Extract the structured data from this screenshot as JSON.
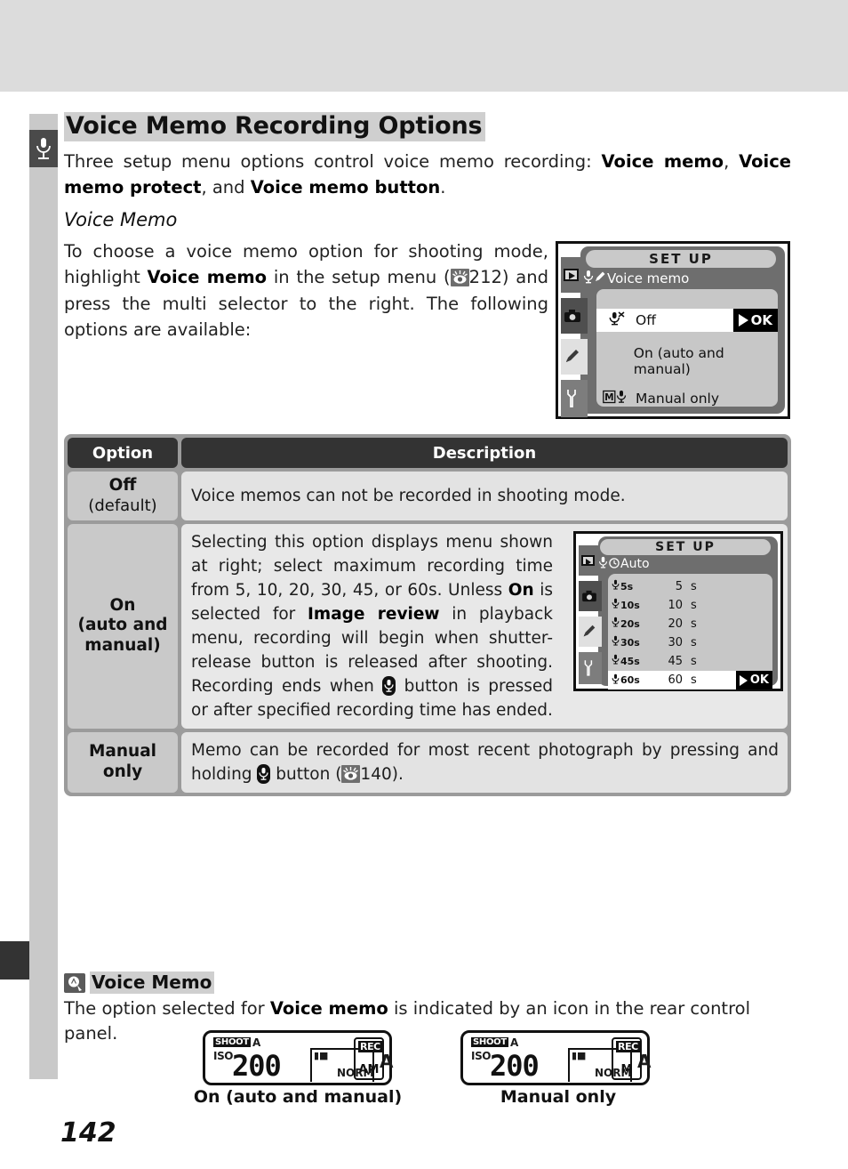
{
  "chapter_tab": {
    "label": "Voice Memos",
    "icon": "microphone-icon"
  },
  "page_title": "Voice Memo Recording Options",
  "intro": {
    "lead": "Three setup menu options control voice memo recording: ",
    "b1": "Voice memo",
    "sep1": ", ",
    "b2": "Voice memo protect",
    "sep2": ", and ",
    "b3": "Voice memo button",
    "end": "."
  },
  "subheading": "Voice Memo",
  "intro2": {
    "part1": "To choose a voice memo option for shooting mode, highlight ",
    "bold1": "Voice memo",
    "part2": " in the setup menu (",
    "ref_icon": "reference-eye-icon",
    "ref_page": "212",
    "part3": ") and press the multi selector to the right. The following options are available:"
  },
  "lcd_voice_memo": {
    "title": "SET UP",
    "subtitle": "Voice memo",
    "subtitle_icons": [
      "mic-icon",
      "pencil-icon"
    ],
    "rail_icons": [
      "playback-icon",
      "camera-icon",
      "pencil-icon",
      "wrench-icon"
    ],
    "rows": [
      {
        "icon": "mic-off-icon",
        "label": "Off",
        "selected": true,
        "ok": "OK"
      },
      {
        "icon": "",
        "label": "On (auto and manual)",
        "selected": false
      },
      {
        "icon": "m-mic-icon",
        "label": "Manual only",
        "selected": false
      }
    ]
  },
  "lcd_auto": {
    "title": "SET UP",
    "subtitle": "Auto",
    "subtitle_icons": [
      "mic-icon",
      "clock-icon"
    ],
    "rail_icons": [
      "playback-icon",
      "camera-icon",
      "pencil-icon",
      "wrench-icon"
    ],
    "rows": [
      {
        "icon_label": "5s",
        "value": "5",
        "unit": "s",
        "selected": false
      },
      {
        "icon_label": "10s",
        "value": "10",
        "unit": "s",
        "selected": false
      },
      {
        "icon_label": "20s",
        "value": "20",
        "unit": "s",
        "selected": false
      },
      {
        "icon_label": "30s",
        "value": "30",
        "unit": "s",
        "selected": false
      },
      {
        "icon_label": "45s",
        "value": "45",
        "unit": "s",
        "selected": false
      },
      {
        "icon_label": "60s",
        "value": "60",
        "unit": "s",
        "selected": true,
        "ok": "OK"
      }
    ]
  },
  "table": {
    "headers": {
      "option": "Option",
      "description": "Description"
    },
    "rows": [
      {
        "option_main": "Off",
        "option_sub": "(default)",
        "description": "Voice memos can not be recorded in shooting mode."
      },
      {
        "option_main": "On",
        "option_sub": "(auto and manual)",
        "option_line1": "On",
        "option_line2": "(auto and",
        "option_line3": "manual)",
        "desc_p1": "Selecting this option displays menu shown at right; select maximum recording time from 5, 10, 20, 30, 45, or 60",
        "desc_unit": "s.  Unless ",
        "desc_b1": "On",
        "desc_p2": " is selected for ",
        "desc_b2": "Image review",
        "desc_p3": " in playback menu, recording will begin when shutter-release button is released after shooting.  Recording ends when ",
        "desc_btn_icon": "mic-button-icon",
        "desc_p4": " button is pressed or after specified recording time has ended."
      },
      {
        "option_line1": "Manual",
        "option_line2": "only",
        "desc_p1": "Memo can be recorded for most recent photograph by pressing and holding ",
        "desc_btn_icon": "mic-button-icon",
        "desc_p2": " button (",
        "desc_ref_icon": "reference-eye-icon",
        "desc_ref_page": "140",
        "desc_p3": ")."
      }
    ]
  },
  "note": {
    "icon": "note-pen-icon",
    "heading": "Voice Memo",
    "body_p1": "The option selected for ",
    "body_b1": "Voice memo",
    "body_p2": " is indicated by an icon in the rear control panel."
  },
  "control_panels": [
    {
      "shoot": "SHOOT",
      "shoot_mode": "A",
      "iso": "ISO",
      "iso_value": "200",
      "quality": "NORM",
      "exposure": "A",
      "rec": "REC",
      "rec_mode": "AM",
      "caption": "On (auto and manual)"
    },
    {
      "shoot": "SHOOT",
      "shoot_mode": "A",
      "iso": "ISO",
      "iso_value": "200",
      "quality": "NORM",
      "exposure": "A",
      "rec": "REC",
      "rec_mode": "M",
      "caption": "Manual only"
    }
  ],
  "page_number": "142"
}
